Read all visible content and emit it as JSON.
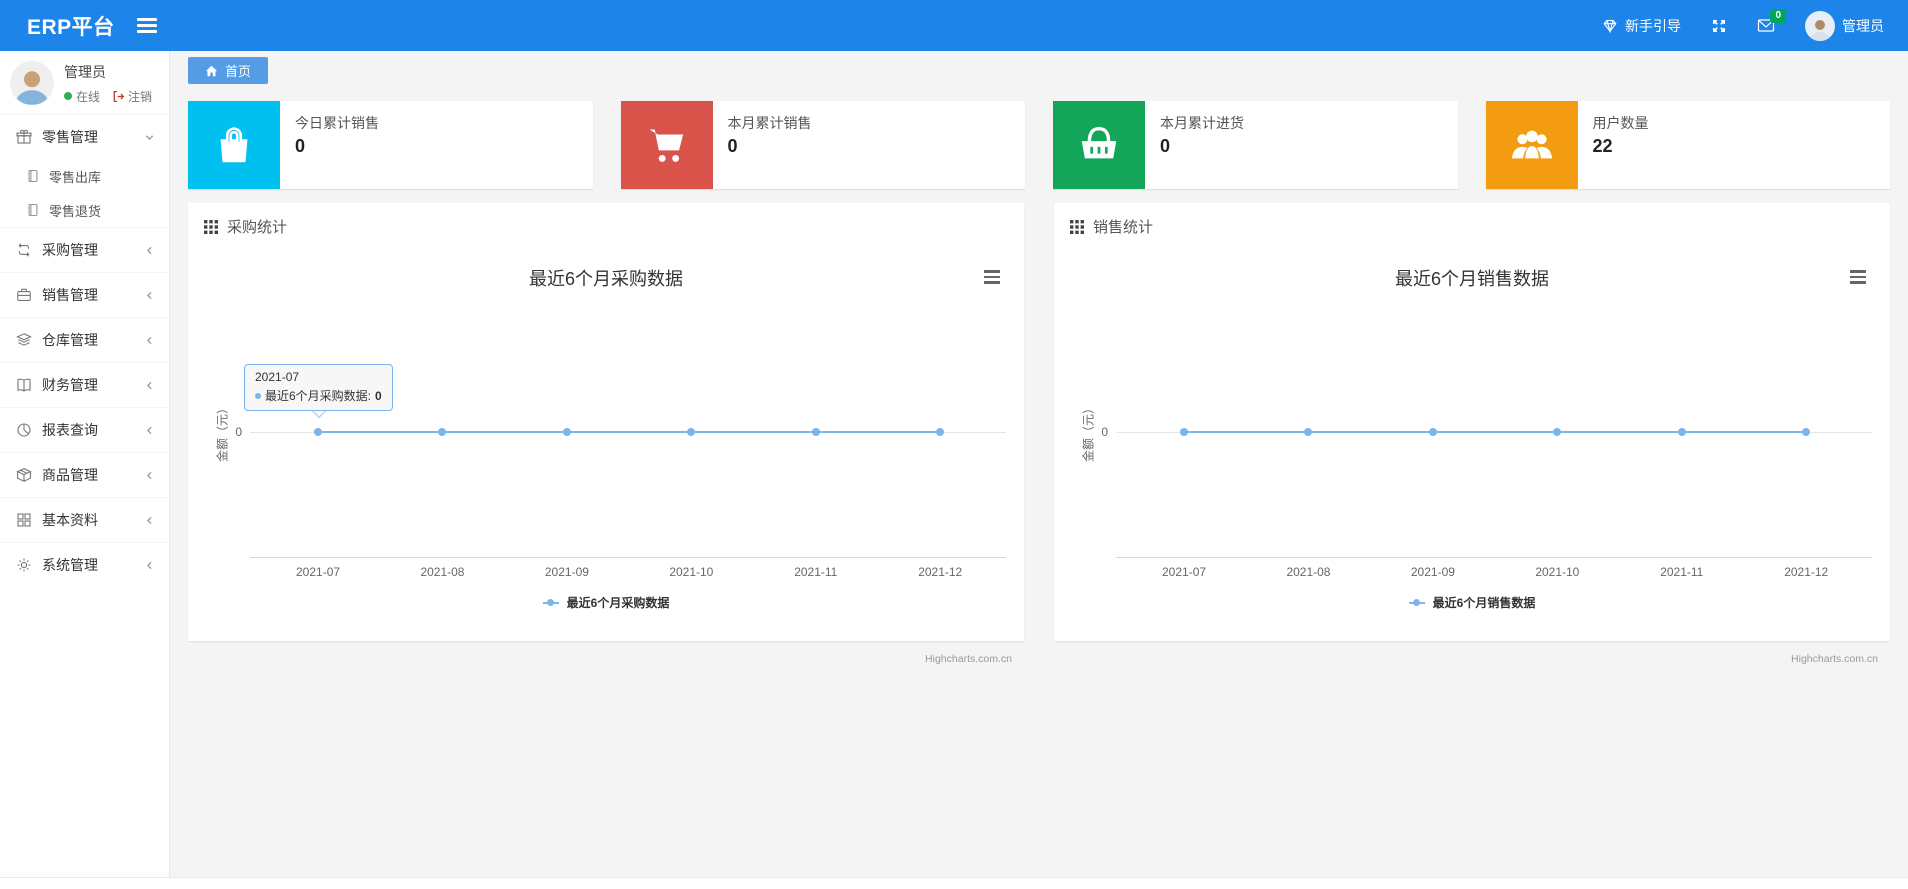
{
  "navbar": {
    "brand": "ERP平台",
    "guide_label": "新手引导",
    "mail_badge": "0",
    "user_name": "管理员",
    "accent_color": "#1d85ea"
  },
  "tabs": {
    "home": "首页"
  },
  "sidebar": {
    "user_name": "管理员",
    "online_label": "在线",
    "logout_label": "注销",
    "items": [
      {
        "label": "零售管理",
        "icon": "gift-icon",
        "state": "expanded"
      },
      {
        "label": "零售出库",
        "icon": "document-icon"
      },
      {
        "label": "零售退货",
        "icon": "document-icon"
      },
      {
        "label": "采购管理",
        "icon": "repeat-icon"
      },
      {
        "label": "销售管理",
        "icon": "briefcase-icon"
      },
      {
        "label": "仓库管理",
        "icon": "layers-icon"
      },
      {
        "label": "财务管理",
        "icon": "book-icon"
      },
      {
        "label": "报表查询",
        "icon": "pie-chart-icon"
      },
      {
        "label": "商品管理",
        "icon": "package-icon"
      },
      {
        "label": "基本资料",
        "icon": "grid-icon"
      },
      {
        "label": "系统管理",
        "icon": "gear-icon"
      }
    ]
  },
  "cards": [
    {
      "title": "今日累计销售",
      "value": "0",
      "color": "#00c0ef",
      "icon": "shopping-bag-icon"
    },
    {
      "title": "本月累计销售",
      "value": "0",
      "color": "#d9534a",
      "icon": "shopping-cart-icon"
    },
    {
      "title": "本月累计进货",
      "value": "0",
      "color": "#13a65a",
      "icon": "shopping-basket-icon"
    },
    {
      "title": "用户数量",
      "value": "22",
      "color": "#f39c12",
      "icon": "users-icon"
    }
  ],
  "chart_data": [
    {
      "type": "line",
      "panel_title": "采购统计",
      "title": "最近6个月采购数据",
      "categories": [
        "2021-07",
        "2021-08",
        "2021-09",
        "2021-10",
        "2021-11",
        "2021-12"
      ],
      "series": [
        {
          "name": "最近6个月采购数据",
          "values": [
            0,
            0,
            0,
            0,
            0,
            0
          ],
          "color": "#7cb5ec"
        }
      ],
      "xlabel": "",
      "ylabel": "金额（元）",
      "y_ticks": [
        "0"
      ],
      "ylim": [
        0,
        1
      ],
      "grid": false,
      "legend_position": "bottom",
      "credits": "Highcharts.com.cn",
      "tooltip": {
        "header": "2021-07",
        "label": "最近6个月采购数据:",
        "value": "0"
      }
    },
    {
      "type": "line",
      "panel_title": "销售统计",
      "title": "最近6个月销售数据",
      "categories": [
        "2021-07",
        "2021-08",
        "2021-09",
        "2021-10",
        "2021-11",
        "2021-12"
      ],
      "series": [
        {
          "name": "最近6个月销售数据",
          "values": [
            0,
            0,
            0,
            0,
            0,
            0
          ],
          "color": "#7cb5ec"
        }
      ],
      "xlabel": "",
      "ylabel": "金额（元）",
      "y_ticks": [
        "0"
      ],
      "ylim": [
        0,
        1
      ],
      "grid": false,
      "legend_position": "bottom",
      "credits": "Highcharts.com.cn"
    }
  ]
}
